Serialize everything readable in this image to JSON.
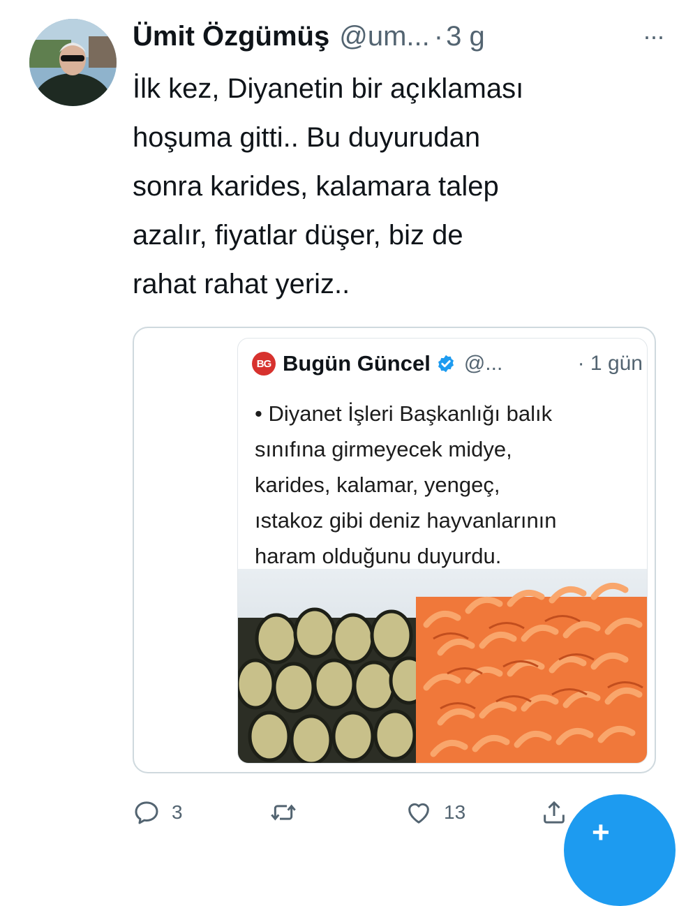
{
  "tweet": {
    "author_name": "Ümit Özgümüş",
    "handle": "@um...",
    "separator": "·",
    "time": "3 g",
    "more_label": "···",
    "text": "İlk kez, Diyanetin bir açıklaması\nhoşuma gitti.. Bu duyurudan\nsonra karides, kalamara talep\nazalır, fiyatlar düşer, biz de\nrahat rahat yeriz.."
  },
  "quoted": {
    "logo_text": "BG",
    "author_name": "Bugün Güncel",
    "handle": "@...",
    "time": "· 1 gün",
    "text": "• Diyanet İşleri Başkanlığı balık\nsınıfına girmeyecek midye,\nkarides, kalamar, yengeç,\nıstakoz gibi deniz hayvanlarının\nharam olduğunu duyurdu.",
    "image_icon": "seafood-photo"
  },
  "actions": {
    "reply_count": "3",
    "retweet_count": "",
    "like_count": "13"
  },
  "fab": {
    "icon": "compose-icon",
    "label": "+"
  },
  "colors": {
    "text_primary": "#0f1419",
    "text_secondary": "#536471",
    "border": "#cfd9de",
    "accent": "#1d9bf0",
    "logo_red": "#d7322e"
  }
}
